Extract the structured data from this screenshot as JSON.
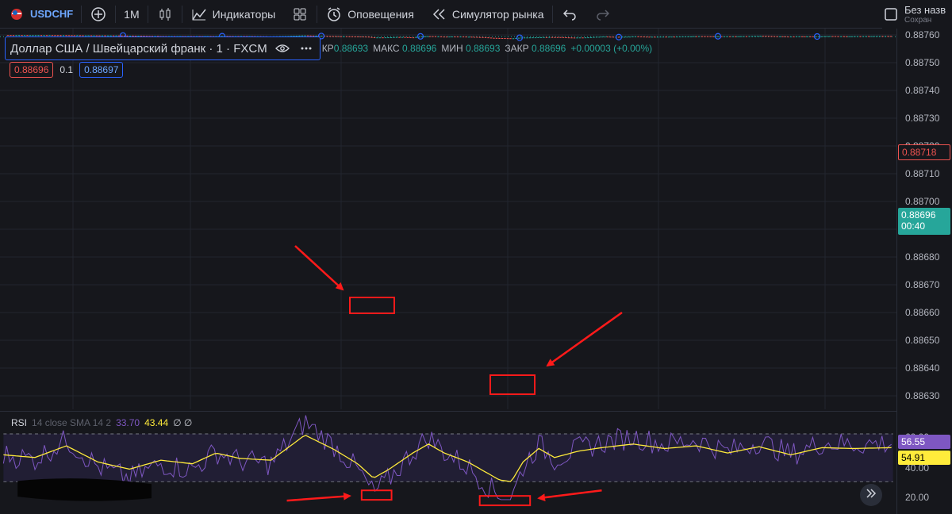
{
  "toolbar": {
    "symbol": "USDCHF",
    "interval": "1M",
    "indicators": "Индикаторы",
    "alerts": "Оповещения",
    "replay": "Симулятор рынка",
    "save_title": "Без назв",
    "save_sub": "Сохран"
  },
  "legend": {
    "title": "Доллар США / Швейцарский франк · 1 · FXCM",
    "open_label": "КР",
    "open": "0.88693",
    "high_label": "МАКС",
    "high": "0.88696",
    "low_label": "МИН",
    "low": "0.88693",
    "close_label": "ЗАКР",
    "close": "0.88696",
    "change": "+0.00003 (+0.00%)"
  },
  "quote": {
    "sell": "0.88696",
    "spread": "0.1",
    "buy": "0.88697"
  },
  "price_axis": [
    "0.88760",
    "0.88750",
    "0.88740",
    "0.88730",
    "0.88720",
    "0.88710",
    "0.88700",
    "0.88690",
    "0.88680",
    "0.88670",
    "0.88660",
    "0.88650",
    "0.88640",
    "0.88630"
  ],
  "badges": {
    "last_price": "0.88718",
    "current_price": "0.88696",
    "countdown": "00:40"
  },
  "rsi": {
    "name": "RSI",
    "params": "14 close SMA 14 2",
    "value1": "33.70",
    "value2": "43.44",
    "value3": "∅ ∅",
    "axis": [
      "60.00",
      "40.00",
      "20.00"
    ],
    "rsi_value": "56.55",
    "sma_value": "54.91"
  },
  "colors": {
    "up": "#26a69a",
    "down": "#ef5350",
    "rsi": "#7e57c2",
    "sma": "#ffeb3b",
    "annotation": "#ff1a1a"
  }
}
